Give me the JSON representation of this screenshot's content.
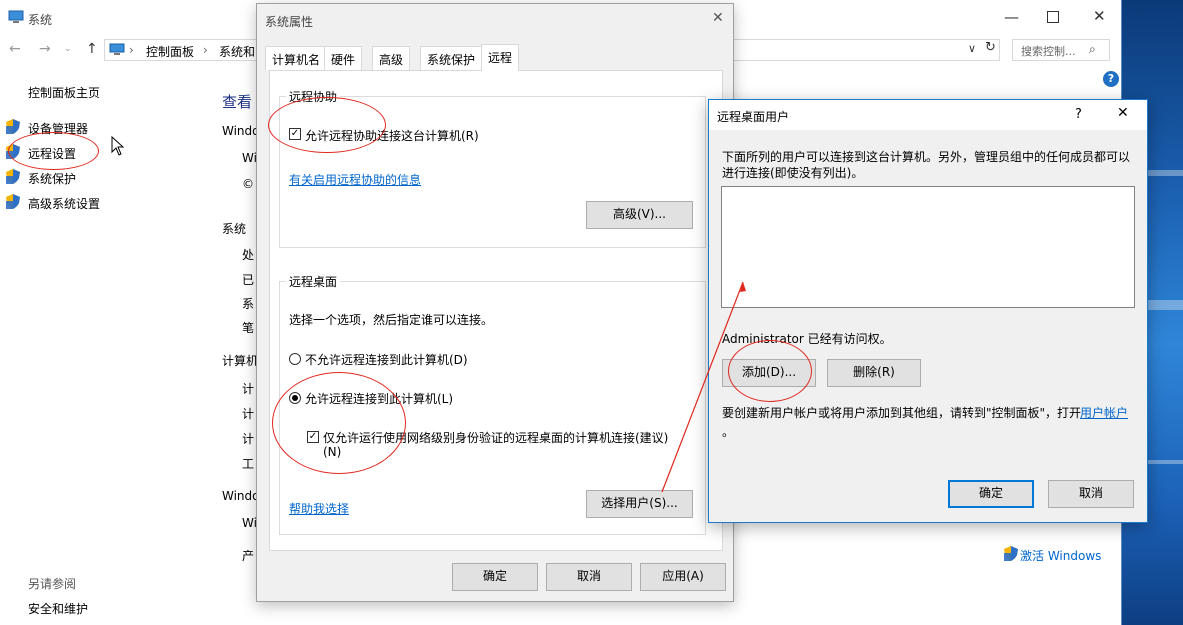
{
  "colors": {
    "accent": "#0078d7",
    "annotation": "#e0281e",
    "link": "#0066cc"
  },
  "sys_window": {
    "title": "系统",
    "icon": "computer-icon",
    "breadcrumb": [
      "控制面板",
      "系统和"
    ],
    "search_placeholder": "搜索控制...",
    "left_nav": {
      "home": "控制面板主页",
      "items": [
        {
          "label": "设备管理器",
          "icon": "shield-icon"
        },
        {
          "label": "远程设置",
          "icon": "shield-icon"
        },
        {
          "label": "系统保护",
          "icon": "shield-icon"
        },
        {
          "label": "高级系统设置",
          "icon": "shield-icon"
        }
      ],
      "see_also_title": "另请参阅",
      "see_also_items": [
        "安全和维护"
      ]
    },
    "main": {
      "heading": "查看",
      "section_windows": "Windo",
      "line_wi": "Wi",
      "line_copy": "©",
      "section_system": "系统",
      "system_rows": [
        "处",
        "已",
        "系",
        "笔"
      ],
      "section_computer": "计算机",
      "computer_rows": [
        "计",
        "计",
        "计",
        "工"
      ],
      "section_activation": "Windo",
      "activation_rows": [
        "Wi",
        "产"
      ],
      "activate_text": "激活 Windows"
    }
  },
  "props_dialog": {
    "title": "系统属性",
    "tabs": [
      "计算机名",
      "硬件",
      "高级",
      "系统保护",
      "远程"
    ],
    "active_tab": 4,
    "remote_assistance": {
      "group_label": "远程协助",
      "checkbox_label": "允许远程协助连接这台计算机(R)",
      "checked": true,
      "info_link": "有关启用远程协助的信息",
      "advanced_button": "高级(V)..."
    },
    "remote_desktop": {
      "group_label": "远程桌面",
      "instruction": "选择一个选项，然后指定谁可以连接。",
      "option_deny": "不允许远程连接到此计算机(D)",
      "option_allow": "允许远程连接到此计算机(L)",
      "selected": "allow",
      "nla_label_1": "仅允许运行使用网络级别身份验证的远程桌面的计算机连接(建议)",
      "nla_label_2": "(N)",
      "nla_checked": true,
      "help_link": "帮助我选择",
      "select_users_button": "选择用户(S)..."
    },
    "buttons": {
      "ok": "确定",
      "cancel": "取消",
      "apply": "应用(A)"
    }
  },
  "rdu_dialog": {
    "title": "远程桌面用户",
    "help": "?",
    "description_1": "下面所列的用户可以连接到这台计算机。另外，管理员组中的任何成员都可以",
    "description_2": "进行连接(即使没有列出)。",
    "users": [],
    "access_note": "Administrator 已经有访问权。",
    "add_button": "添加(D)...",
    "remove_button": "删除(R)",
    "create_note_1": "要创建新用户帐户或将用户添加到其他组，请转到\"控制面板\"，打开",
    "create_note_link": "用户帐户",
    "create_note_2": "。",
    "ok_button": "确定",
    "cancel_button": "取消"
  }
}
